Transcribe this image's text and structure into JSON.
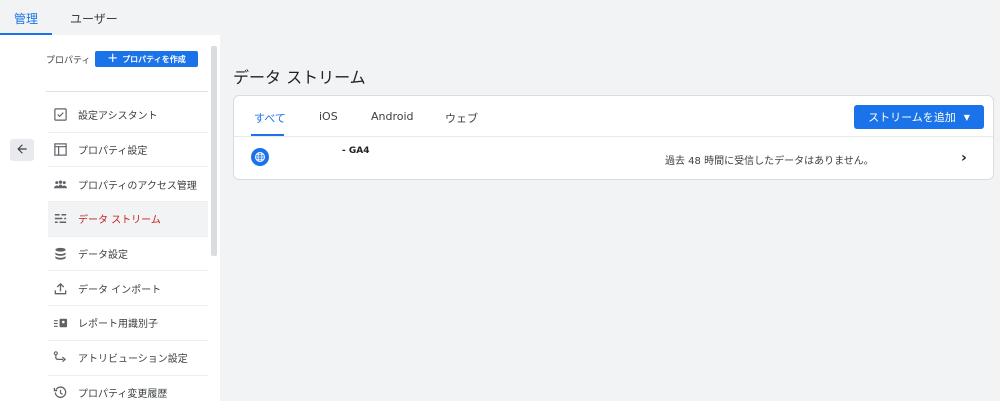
{
  "top_tabs": [
    {
      "label": "管理",
      "active": true
    },
    {
      "label": "ユーザー",
      "active": false
    }
  ],
  "sidebar": {
    "property_label": "プロパティ",
    "create_property_label": "プロパティを作成",
    "items": [
      {
        "label": "設定アシスタント",
        "icon": "checklist-icon"
      },
      {
        "label": "プロパティ設定",
        "icon": "settings-layout-icon"
      },
      {
        "label": "プロパティのアクセス管理",
        "icon": "people-icon"
      },
      {
        "label": "データ ストリーム",
        "icon": "stream-icon",
        "active": true
      },
      {
        "label": "データ設定",
        "icon": "database-icon"
      },
      {
        "label": "データ インポート",
        "icon": "upload-icon"
      },
      {
        "label": "レポート用識別子",
        "icon": "id-icon"
      },
      {
        "label": "アトリビューション設定",
        "icon": "route-icon"
      },
      {
        "label": "プロパティ変更履歴",
        "icon": "history-icon"
      }
    ]
  },
  "main": {
    "title": "データ ストリーム",
    "tabs": [
      {
        "label": "すべて",
        "active": true
      },
      {
        "label": "iOS"
      },
      {
        "label": "Android"
      },
      {
        "label": "ウェブ"
      }
    ],
    "add_stream_label": "ストリームを追加",
    "streams": [
      {
        "name": "- GA4",
        "type": "web",
        "status": "過去 48 時間に受信したデータはありません。"
      }
    ]
  },
  "colors": {
    "accent": "#1a73e8",
    "active_nav_text": "#c5221f",
    "background": "#f1f3f4"
  }
}
